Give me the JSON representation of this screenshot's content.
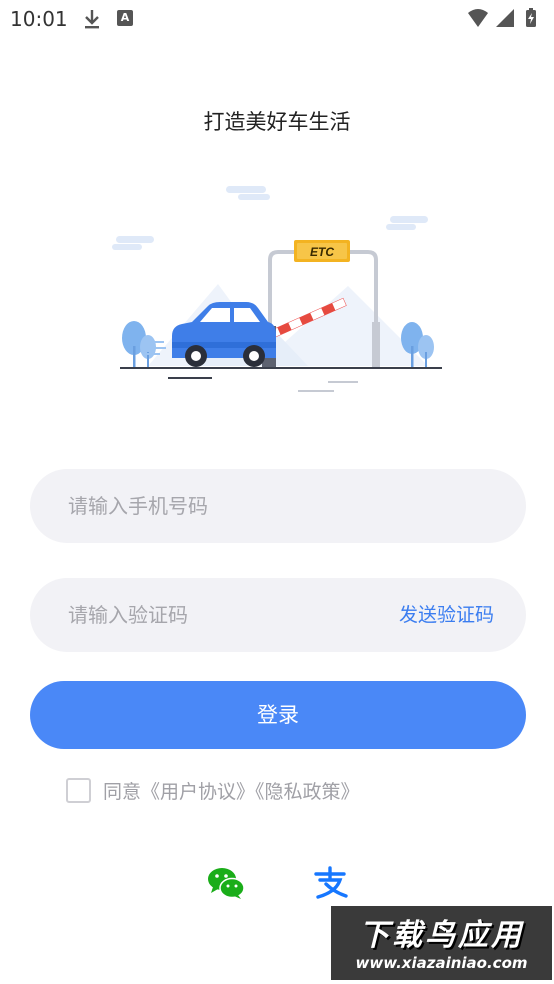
{
  "status_bar": {
    "time": "10:01",
    "icons": [
      "download-icon",
      "a-notification-icon",
      "wifi-icon",
      "signal-icon",
      "battery-icon"
    ]
  },
  "header": {
    "tagline": "打造美好车生活"
  },
  "hero": {
    "sign_text": "ETC",
    "illustration": "car-at-etc-toll-gate"
  },
  "form": {
    "phone": {
      "placeholder": "请输入手机号码",
      "value": ""
    },
    "code": {
      "placeholder": "请输入验证码",
      "value": "",
      "send_label": "发送验证码"
    },
    "login_label": "登录",
    "agreement": {
      "checked": false,
      "text": "同意《用户协议》《隐私政策》"
    }
  },
  "third_party": {
    "icons": [
      "wechat-icon",
      "alipay-icon"
    ]
  },
  "watermark": {
    "title": "下载鸟应用",
    "url": "www.xiazainiao.com"
  },
  "colors": {
    "accent": "#4a88f7",
    "link": "#3b7df0",
    "field_bg": "#f2f2f6",
    "wechat": "#1aad19",
    "alipay": "#1677ff"
  }
}
